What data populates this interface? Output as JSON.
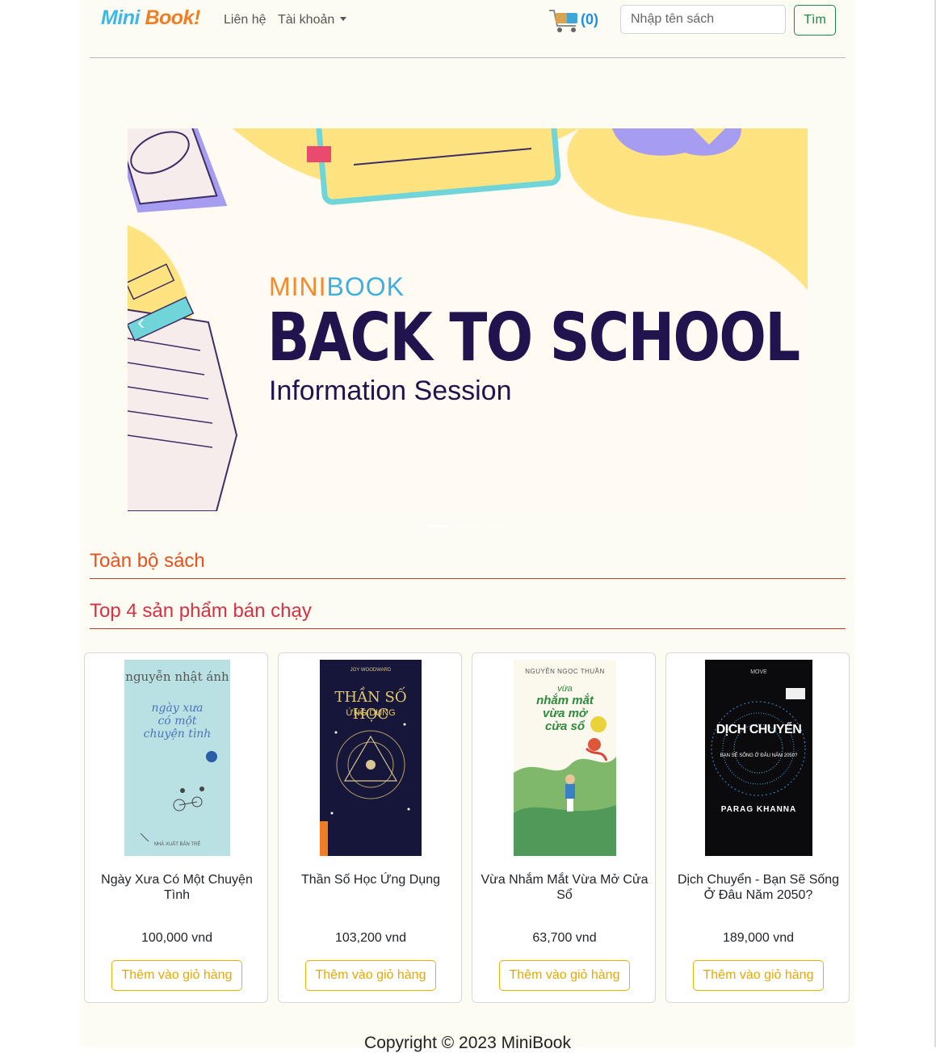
{
  "brand": {
    "part1": "Mini",
    "part2": "Book!"
  },
  "nav": {
    "contact_label": "Liên hệ",
    "account_label": "Tài khoản",
    "cart_count": "(0)",
    "search_placeholder": "Nhập tên sách",
    "search_button": "Tìm"
  },
  "banner": {
    "brand_part1": "MINI",
    "brand_part2": "BOOK",
    "title": "BACK TO SCHOOL",
    "subtitle": "Information Session",
    "prev_control": "‹",
    "slides_total": 3,
    "active_slide": 1
  },
  "sections": {
    "all_books": "Toàn bộ sách",
    "top_sellers": "Top 4 sản phẩm bán chạy"
  },
  "products": [
    {
      "title": "Ngày Xưa Có Một Chuyện Tình",
      "price": "100,000 vnd",
      "button": "Thêm vào giỏ hàng",
      "cover": {
        "author": "nguyễn nhật ánh",
        "line1": "ngày xưa",
        "line2": "có một",
        "line3": "chuyện tình",
        "publisher": "NHÀ XUẤT BẢN TRẺ"
      }
    },
    {
      "title": "Thần Số Học Ứng Dụng",
      "price": "103,200 vnd",
      "button": "Thêm vào giỏ hàng",
      "cover": {
        "author": "JOY WOODWARD",
        "line1": "THẦN SỐ HỌC",
        "line2": "ỨNG DỤNG"
      }
    },
    {
      "title": "Vừa Nhắm Mắt Vừa Mở Cửa Sổ",
      "price": "63,700 vnd",
      "button": "Thêm vào giỏ hàng",
      "cover": {
        "author": "NGUYỄN NGỌC THUẦN",
        "line1": "vừa",
        "line2": "nhắm mắt",
        "line3": "vừa mở",
        "line4": "cửa sổ"
      }
    },
    {
      "title": "Dịch Chuyển - Bạn Sẽ Sống Ở Đâu Năm 2050?",
      "price": "189,000 vnd",
      "button": "Thêm vào giỏ hàng",
      "cover": {
        "top": "MOVE",
        "line1": "DỊCH CHUYỂN",
        "line2": "BẠN SẼ SỐNG Ở ĐÂU NĂM 2050?",
        "author": "PARAG KHANNA"
      }
    }
  ],
  "footer": {
    "copyright": "Copyright © 2023 MiniBook"
  }
}
